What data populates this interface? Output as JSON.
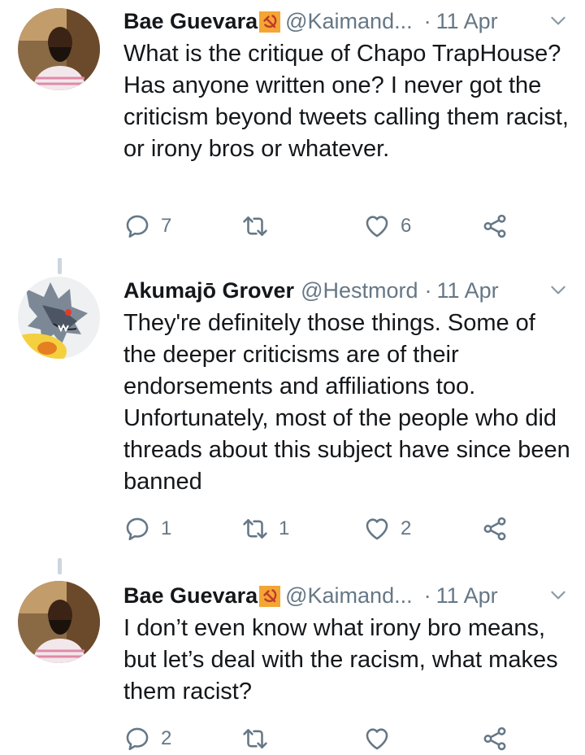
{
  "tweets": [
    {
      "name": "Bae Guevara",
      "handle": "@Kaimand...",
      "separator": "·",
      "time": "11 Apr",
      "text": "What is the critique of Chapo TrapHouse? Has anyone written one? I never got the criticism beyond tweets calling them racist, or irony bros or whatever.",
      "replies": "7",
      "retweets": "",
      "likes": "6"
    },
    {
      "name": "Akumajō Grover",
      "handle": "@Hestmord",
      "separator": "·",
      "time": "11 Apr",
      "text": "They're definitely those things. Some of the deeper criticisms are of their endorsements and affiliations too. Unfortunately, most of the people who did threads about this subject have since been banned",
      "replies": "1",
      "retweets": "1",
      "likes": "2"
    },
    {
      "name": "Bae Guevara",
      "handle": "@Kaimand...",
      "separator": "·",
      "time": "11 Apr",
      "text": "I don’t even know what irony bro means, but let’s deal with the racism, what makes them racist?",
      "replies": "2",
      "retweets": "",
      "likes": ""
    }
  ],
  "colors": {
    "muted": "#657786",
    "text": "#14171a",
    "thread_line": "#ccd6dd",
    "badge": "#f3a634"
  },
  "icons": [
    "reply-icon",
    "retweet-icon",
    "like-icon",
    "share-icon",
    "chevron-down-icon",
    "hammer-sickle-icon"
  ]
}
